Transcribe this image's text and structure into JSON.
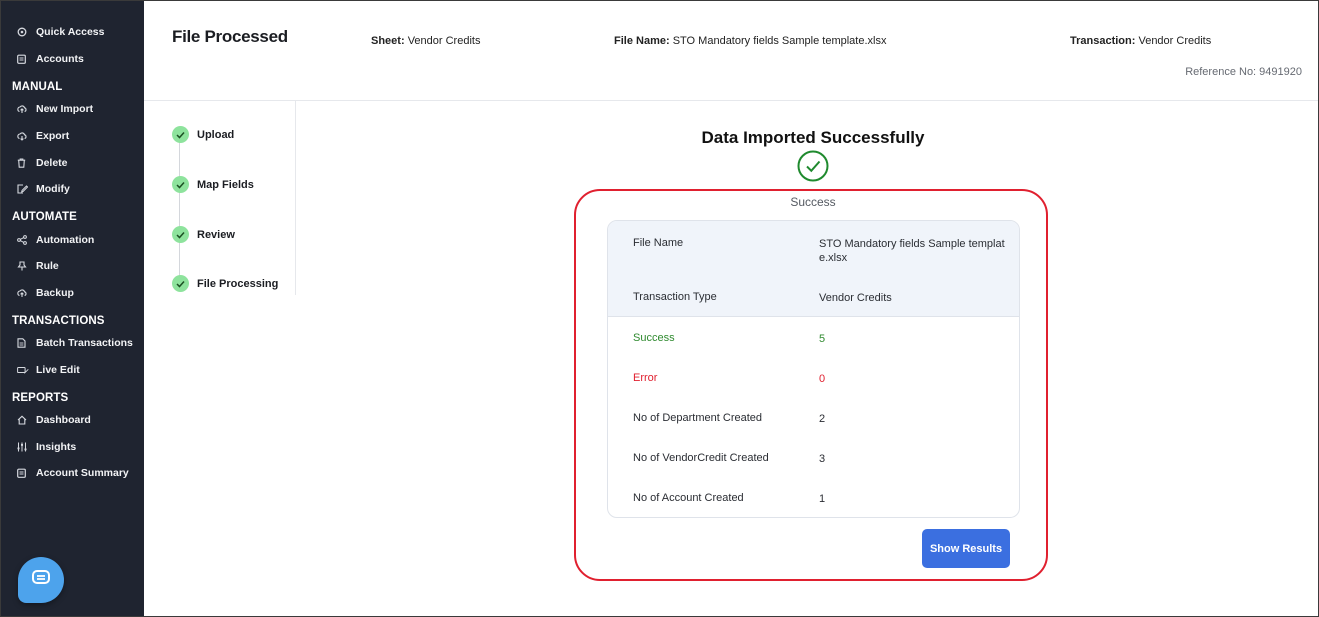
{
  "sidebar": {
    "top_items": [
      {
        "label": "Quick Access",
        "icon": "quick-access-icon"
      },
      {
        "label": "Accounts",
        "icon": "accounts-icon"
      }
    ],
    "sections": [
      {
        "title": "MANUAL",
        "items": [
          {
            "label": "New Import",
            "icon": "upload-cloud-icon"
          },
          {
            "label": "Export",
            "icon": "download-cloud-icon"
          },
          {
            "label": "Delete",
            "icon": "trash-icon"
          },
          {
            "label": "Modify",
            "icon": "edit-icon"
          }
        ]
      },
      {
        "title": "AUTOMATE",
        "items": [
          {
            "label": "Automation",
            "icon": "share-icon"
          },
          {
            "label": "Rule",
            "icon": "pin-icon"
          },
          {
            "label": "Backup",
            "icon": "backup-cloud-icon"
          }
        ]
      },
      {
        "title": "TRANSACTIONS",
        "items": [
          {
            "label": "Batch Transactions",
            "icon": "document-icon"
          },
          {
            "label": "Live Edit",
            "icon": "live-edit-icon"
          }
        ]
      },
      {
        "title": "REPORTS",
        "items": [
          {
            "label": "Dashboard",
            "icon": "home-icon"
          },
          {
            "label": "Insights",
            "icon": "sliders-icon"
          },
          {
            "label": "Account Summary",
            "icon": "clipboard-icon"
          }
        ]
      }
    ]
  },
  "header": {
    "title": "File Processed",
    "sheet_label": "Sheet:",
    "sheet_value": "Vendor Credits",
    "file_label": "File Name:",
    "file_value": "STO Mandatory fields Sample template.xlsx",
    "transaction_label": "Transaction:",
    "transaction_value": "Vendor Credits",
    "reference": "Reference No: 9491920"
  },
  "steps": [
    {
      "label": "Upload",
      "status": "complete"
    },
    {
      "label": "Map Fields",
      "status": "complete"
    },
    {
      "label": "Review",
      "status": "complete"
    },
    {
      "label": "File Processing",
      "status": "complete"
    }
  ],
  "result": {
    "title": "Data Imported Successfully",
    "caption": "Success",
    "file_name_label": "File Name",
    "file_name_value": "STO Mandatory fields Sample template.xlsx",
    "transaction_type_label": "Transaction Type",
    "transaction_type_value": "Vendor Credits",
    "stats": [
      {
        "label": "Success",
        "value": "5",
        "tone": "green"
      },
      {
        "label": "Error",
        "value": "0",
        "tone": "red"
      },
      {
        "label": "No of Department Created",
        "value": "2",
        "tone": "normal"
      },
      {
        "label": "No of VendorCredit Created",
        "value": "3",
        "tone": "normal"
      },
      {
        "label": "No of Account Created",
        "value": "1",
        "tone": "normal"
      }
    ],
    "button_label": "Show Results"
  },
  "colors": {
    "sidebar_bg": "#1f2430",
    "accent_blue": "#3b6fe0",
    "success_green": "#2f8a2f",
    "error_red": "#e0202f",
    "step_green": "#8ee39d",
    "highlight_red": "#e0202f"
  }
}
